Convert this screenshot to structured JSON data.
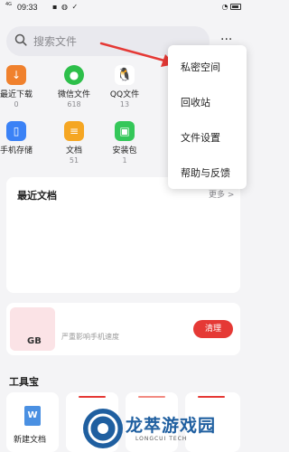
{
  "status_bar": {
    "network": "4G",
    "time": "09:33",
    "battery": "100"
  },
  "search": {
    "placeholder": "搜索文件"
  },
  "more_button": "···",
  "grid": [
    {
      "label": "最近下载",
      "count": "0",
      "icon": "download-icon",
      "color": "#f0812d",
      "glyph": "↓"
    },
    {
      "label": "微信文件",
      "count": "618",
      "icon": "wechat-icon",
      "color": "#2dbf4a",
      "glyph": "●"
    },
    {
      "label": "QQ文件",
      "count": "13",
      "icon": "qq-icon",
      "color": "#ffffff",
      "glyph": "🐧"
    },
    {
      "label": "手机存储",
      "count": "",
      "icon": "phone-storage-icon",
      "color": "#3b82f6",
      "glyph": "▯"
    },
    {
      "label": "文档",
      "count": "51",
      "icon": "document-icon",
      "color": "#f5a623",
      "glyph": "≡"
    },
    {
      "label": "安装包",
      "count": "1",
      "icon": "package-icon",
      "color": "#34c759",
      "glyph": "▣"
    }
  ],
  "recent": {
    "title": "最近文档",
    "more": "更多 >"
  },
  "storage": {
    "size": "GB",
    "text": "严重影响手机速度",
    "clean_button": "清理"
  },
  "toolbox": {
    "title": "工具宝",
    "items": [
      {
        "label": "新建文档",
        "icon": "word-doc-icon",
        "glyph": "W"
      }
    ]
  },
  "menu": {
    "items": [
      "私密空间",
      "回收站",
      "文件设置",
      "帮助与反馈"
    ]
  },
  "watermark": {
    "title": "龙萃游戏园",
    "subtitle": "LONGCUI TECH"
  },
  "colors": {
    "accent_red": "#e53935",
    "watermark_blue": "#1f5fa0"
  }
}
